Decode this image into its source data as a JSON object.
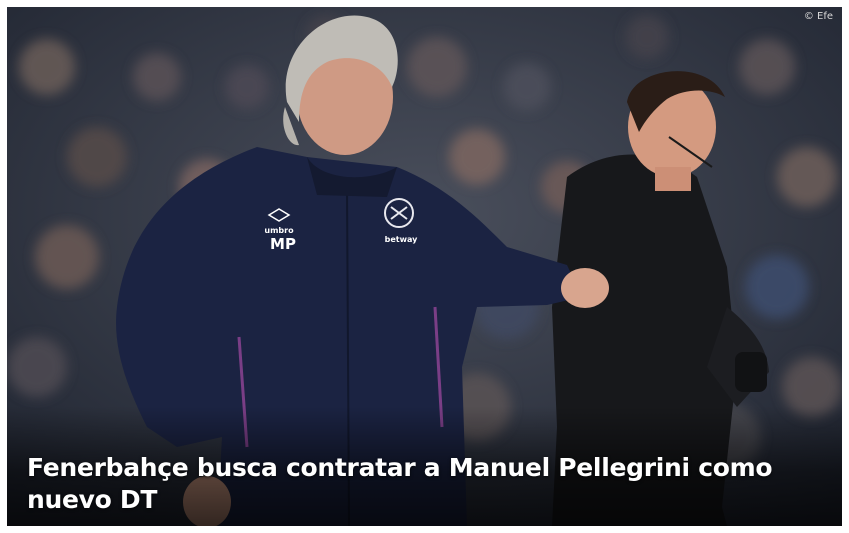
{
  "article": {
    "headline": "Fenerbahçe busca contratar a Manuel Pellegrini como nuevo DT",
    "photo_credit": "© Efe"
  },
  "jacket": {
    "brand_text": "umbro",
    "initials": "MP",
    "sponsor_text": "betway"
  },
  "colors": {
    "jacket_navy": "#1b2342",
    "referee_black": "#17181b",
    "crowd_bg": "#2d3342",
    "headline_text": "#ffffff"
  },
  "icons": {
    "club_crest": "west-ham-crest-icon",
    "kit_logo": "umbro-logo-icon"
  }
}
